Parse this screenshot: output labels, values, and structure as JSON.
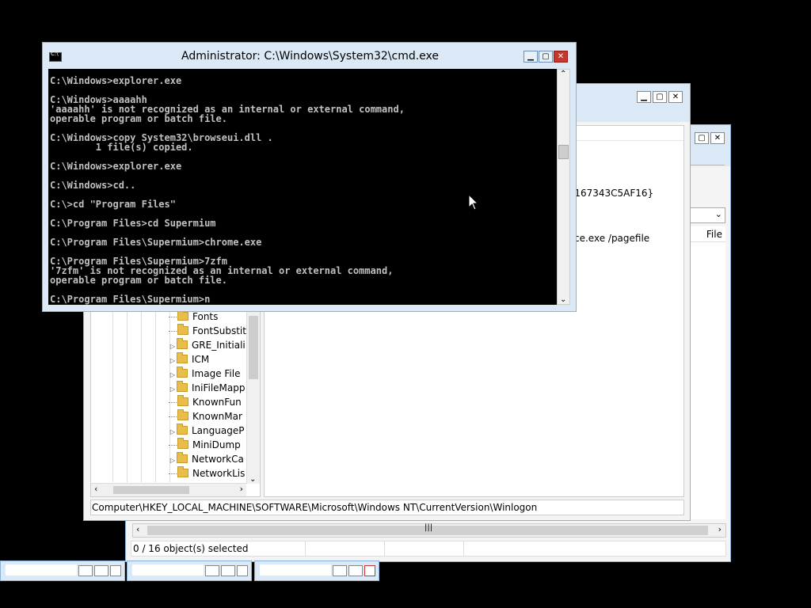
{
  "cmd": {
    "title": "Administrator: C:\\Windows\\System32\\cmd.exe",
    "icon": "cmd-icon",
    "lines": [
      "C:\\Windows>explorer.exe",
      "",
      "C:\\Windows>aaaahh",
      "'aaaahh' is not recognized as an internal or external command,",
      "operable program or batch file.",
      "",
      "C:\\Windows>copy System32\\browseui.dll .",
      "        1 file(s) copied.",
      "",
      "C:\\Windows>explorer.exe",
      "",
      "C:\\Windows>cd..",
      "",
      "C:\\>cd \"Program Files\"",
      "",
      "C:\\Program Files>cd Supermium",
      "",
      "C:\\Program Files\\Supermium>chrome.exe",
      "",
      "C:\\Program Files\\Supermium>7zfm",
      "'7zfm' is not recognized as an internal or external command,",
      "operable program or batch file.",
      "",
      "C:\\Program Files\\Supermium>n"
    ]
  },
  "regedit": {
    "tree_items": [
      {
        "label": "Fonts",
        "expandable": false
      },
      {
        "label": "FontSubstit",
        "expandable": false
      },
      {
        "label": "GRE_Initiali",
        "expandable": true
      },
      {
        "label": "ICM",
        "expandable": true
      },
      {
        "label": "Image File ",
        "expandable": true
      },
      {
        "label": "IniFileMapp",
        "expandable": true
      },
      {
        "label": "KnownFun",
        "expandable": false
      },
      {
        "label": "KnownMar",
        "expandable": false
      },
      {
        "label": "LanguageP",
        "expandable": true
      },
      {
        "label": "MiniDump",
        "expandable": false
      },
      {
        "label": "NetworkCa",
        "expandable": true
      },
      {
        "label": "NetworkLis",
        "expandable": false
      }
    ],
    "value_fragments": {
      "guid_tail": "-167343C5AF16}",
      "pagefile": "ce.exe /pagefile"
    },
    "status_path": "Computer\\HKEY_LOCAL_MACHINE\\SOFTWARE\\Microsoft\\Windows NT\\CurrentVersion\\Winlogon"
  },
  "explorer": {
    "column_header": "File",
    "status_text": "0 / 16 object(s) selected"
  }
}
